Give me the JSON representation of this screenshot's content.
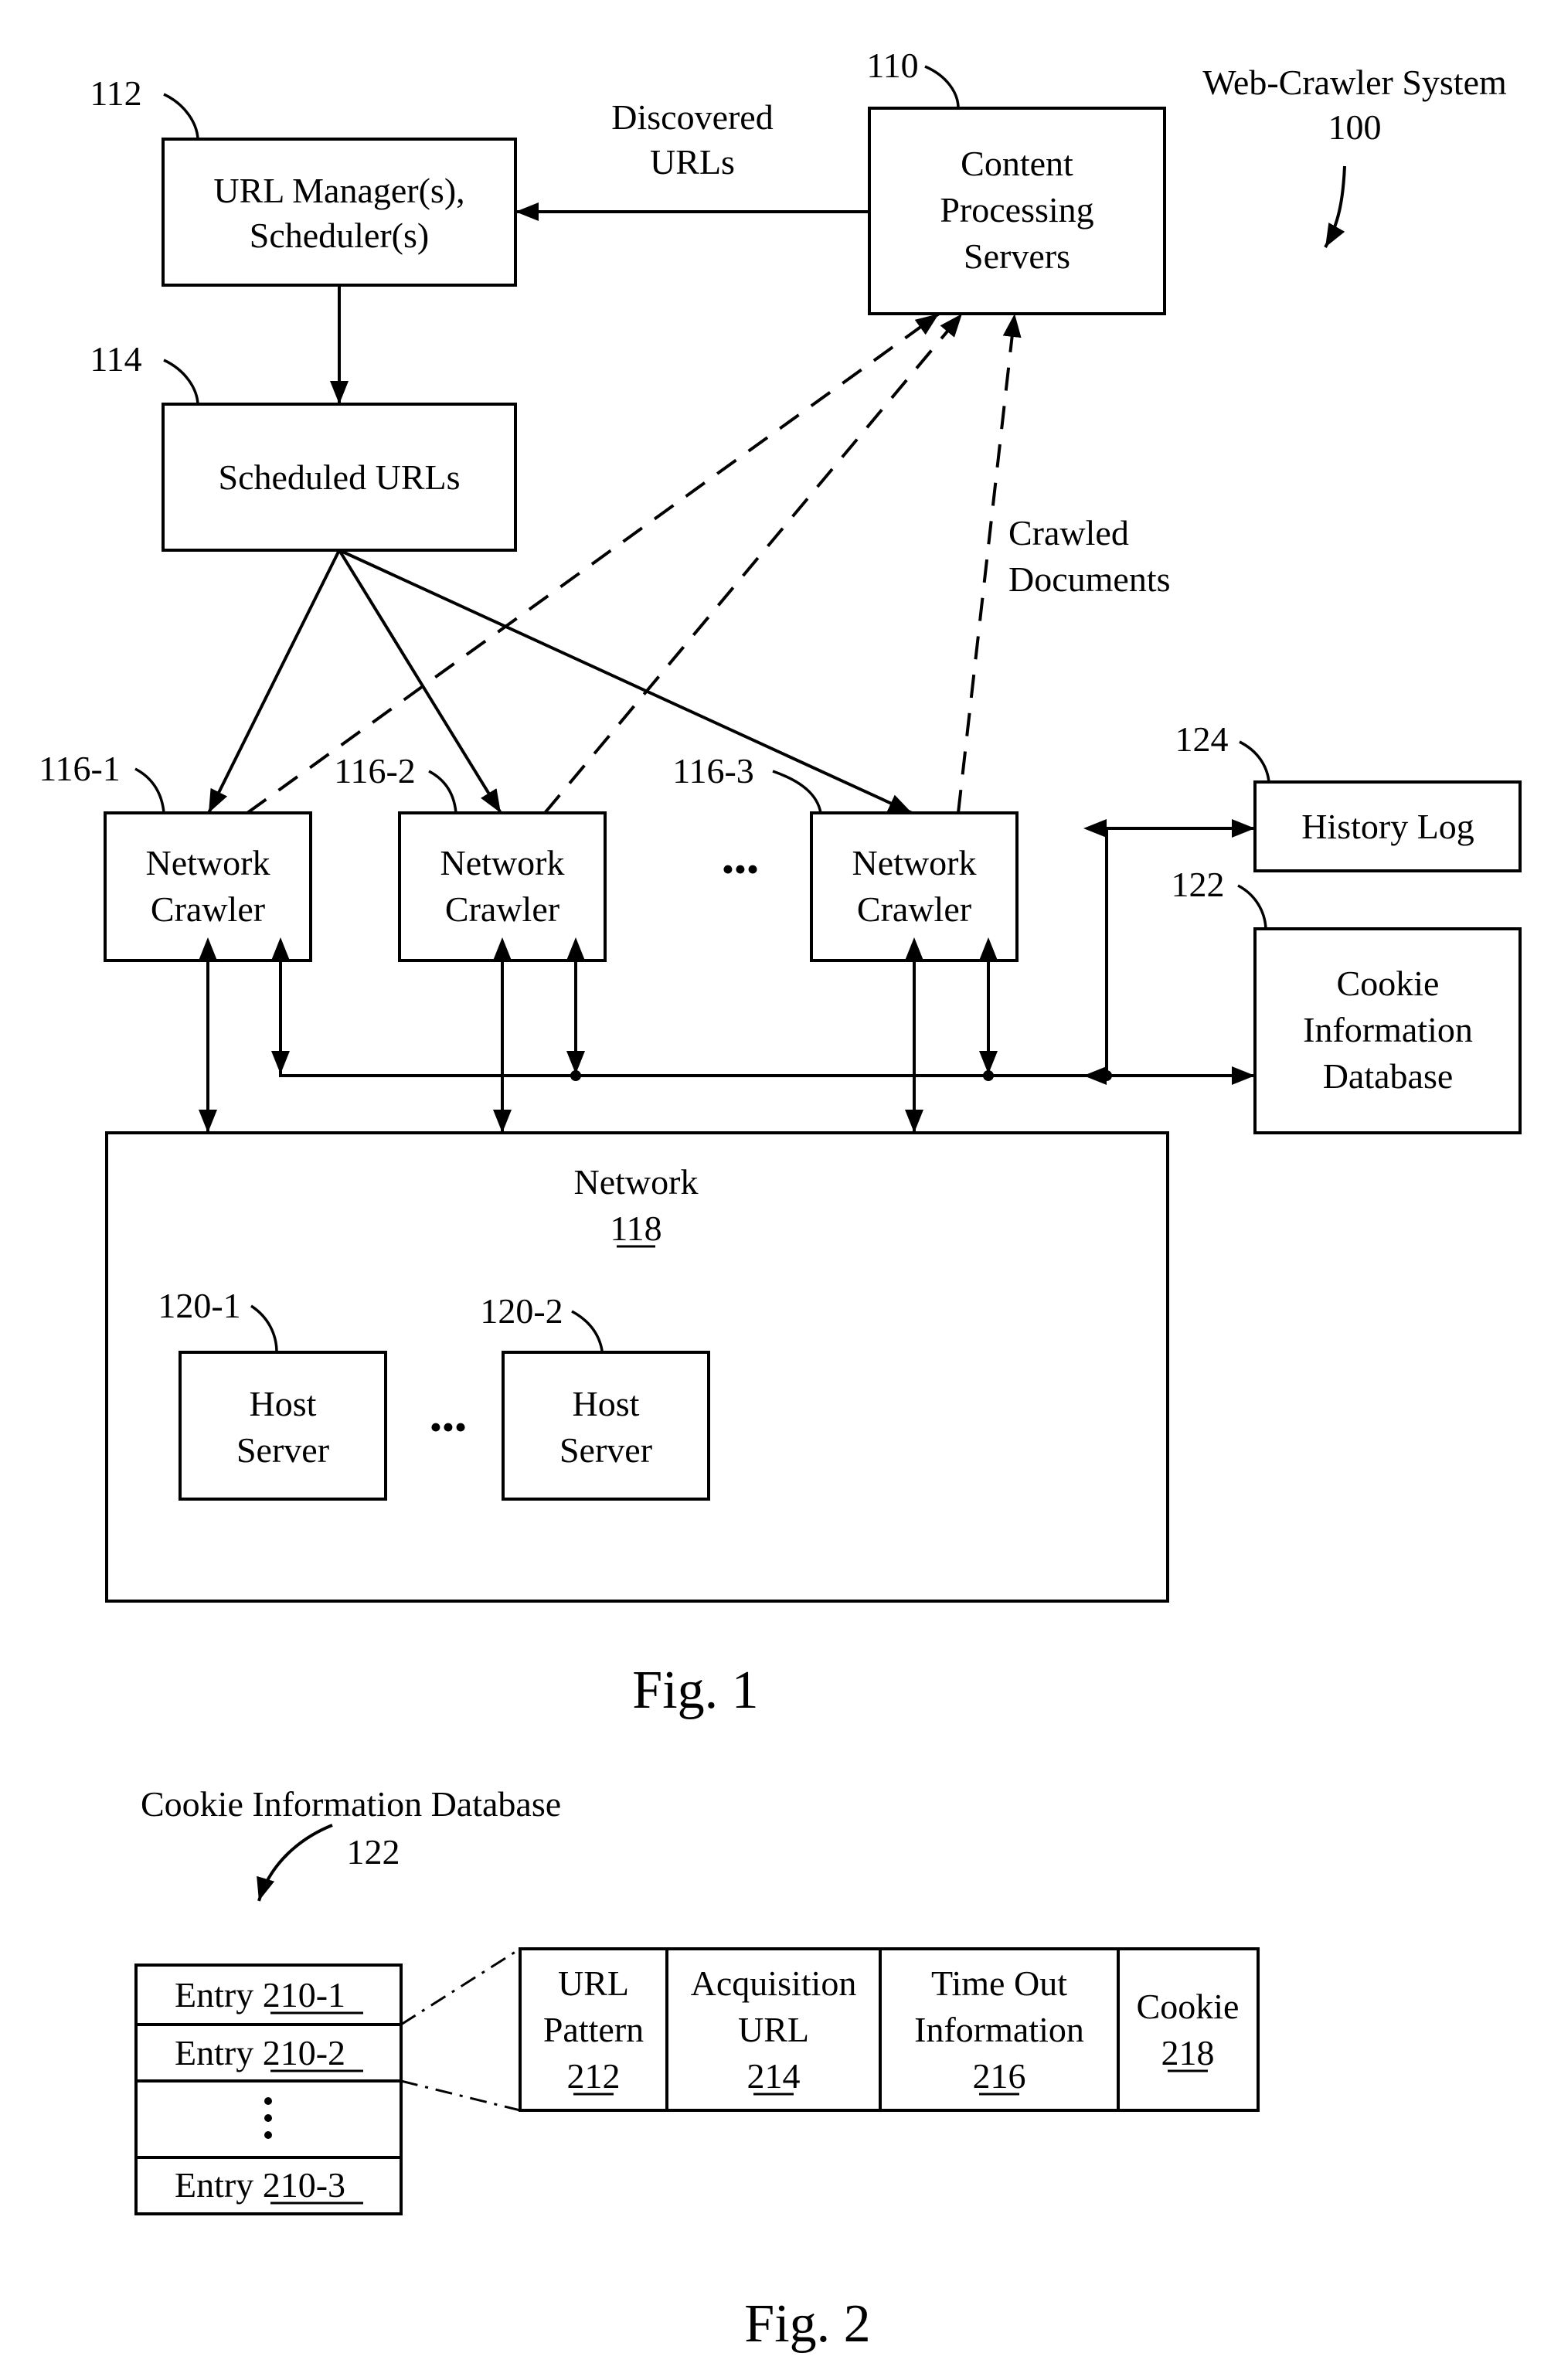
{
  "fig1": {
    "system_title": "Web-Crawler System",
    "system_ref": "100",
    "url_manager": {
      "ref": "112",
      "lines": [
        "URL Manager(s),",
        "Scheduler(s)"
      ]
    },
    "scheduled_urls": {
      "ref": "114",
      "lines": [
        "Scheduled URLs"
      ]
    },
    "content_processing": {
      "ref": "110",
      "lines": [
        "Content",
        "Processing",
        "Servers"
      ]
    },
    "discovered_urls_label": [
      "Discovered",
      "URLs"
    ],
    "crawled_documents_label": [
      "Crawled",
      "Documents"
    ],
    "crawlers": [
      {
        "ref": "116-1",
        "lines": [
          "Network",
          "Crawler"
        ]
      },
      {
        "ref": "116-2",
        "lines": [
          "Network",
          "Crawler"
        ]
      },
      {
        "ref": "116-3",
        "lines": [
          "Network",
          "Crawler"
        ]
      }
    ],
    "crawler_ellipsis": "•••",
    "history_log": {
      "ref": "124",
      "lines": [
        "History Log"
      ]
    },
    "cookie_db": {
      "ref": "122",
      "lines": [
        "Cookie",
        "Information",
        "Database"
      ]
    },
    "network": {
      "label": "Network",
      "ref": "118"
    },
    "hosts": [
      {
        "ref": "120-1",
        "lines": [
          "Host",
          "Server"
        ]
      },
      {
        "ref": "120-2",
        "lines": [
          "Host",
          "Server"
        ]
      }
    ],
    "host_ellipsis": "•••",
    "caption": "Fig. 1"
  },
  "fig2": {
    "title": "Cookie Information Database",
    "ref": "122",
    "entries": [
      {
        "label": "Entry",
        "ref": "210-1"
      },
      {
        "label": "Entry",
        "ref": "210-2"
      },
      {
        "label": "Entry",
        "ref": "210-3"
      }
    ],
    "vertical_ellipsis": "⋮",
    "fields": [
      {
        "lines": [
          "URL",
          "Pattern"
        ],
        "ref": "212"
      },
      {
        "lines": [
          "Acquisition",
          "URL"
        ],
        "ref": "214"
      },
      {
        "lines": [
          "Time Out",
          "Information"
        ],
        "ref": "216"
      },
      {
        "lines": [
          "Cookie"
        ],
        "ref": "218"
      }
    ],
    "caption": "Fig. 2"
  }
}
